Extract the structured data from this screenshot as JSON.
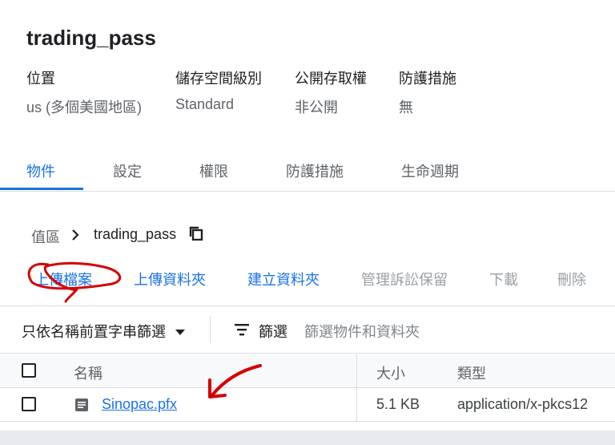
{
  "bucket": {
    "name": "trading_pass"
  },
  "details": [
    {
      "label": "位置",
      "value": "us (多個美國地區)"
    },
    {
      "label": "儲存空間級別",
      "value": "Standard"
    },
    {
      "label": "公開存取權",
      "value": "非公開"
    },
    {
      "label": "防護措施",
      "value": "無"
    }
  ],
  "tabs": [
    "物件",
    "設定",
    "權限",
    "防護措施",
    "生命週期"
  ],
  "active_tab": "物件",
  "breadcrumb": {
    "root": "值區",
    "current": "trading_pass"
  },
  "actions": {
    "upload_files": "上傳檔案",
    "upload_folder": "上傳資料夾",
    "create_folder": "建立資料夾",
    "manage_holds": "管理訴訟保留",
    "download": "下載",
    "delete": "刪除"
  },
  "filter": {
    "prefix_filter": "只依名稱前置字串篩選",
    "filter_label": "篩選",
    "placeholder": "篩選物件和資料夾"
  },
  "table": {
    "columns": {
      "name": "名稱",
      "size": "大小",
      "type": "類型"
    },
    "rows": [
      {
        "name": "Sinopac.pfx",
        "size": "5.1 KB",
        "type": "application/x-pkcs12"
      }
    ]
  },
  "colors": {
    "accent": "#1a73e8",
    "annotation": "#d50000"
  },
  "icons": {
    "copy": "copy-icon",
    "dropdown": "dropdown-caret-icon",
    "filter": "filter-lines-icon",
    "file": "document-icon",
    "breadcrumb_separator": "chevron-right-icon"
  }
}
